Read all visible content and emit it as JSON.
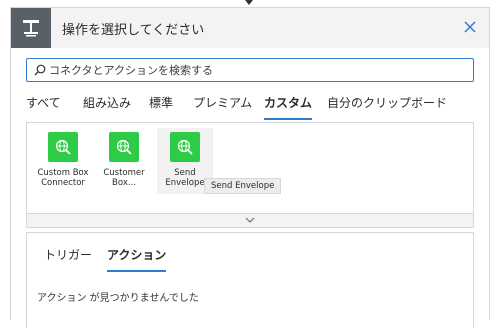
{
  "header": {
    "title": "操作を選択してください"
  },
  "search": {
    "placeholder": "コネクタとアクションを検索する",
    "value": ""
  },
  "tabs": [
    {
      "label": "すべて"
    },
    {
      "label": "組み込み"
    },
    {
      "label": "標準"
    },
    {
      "label": "プレミアム"
    },
    {
      "label": "カスタム",
      "active": true
    },
    {
      "label": "自分のクリップボード"
    }
  ],
  "connectors": [
    {
      "label": "Custom Box Connector",
      "icon": "globe-search-icon"
    },
    {
      "label": "Customer Box...",
      "icon": "globe-search-icon"
    },
    {
      "label": "Send Envelope",
      "icon": "globe-search-icon"
    }
  ],
  "tooltip": {
    "text": "Send Envelope"
  },
  "subtabs": [
    {
      "label": "トリガー"
    },
    {
      "label": "アクション",
      "active": true
    }
  ],
  "empty_message": "アクション が見つかりませんでした",
  "colors": {
    "accent": "#2e7bd4",
    "connector_green": "#2ecb47",
    "header_icon_bg": "#5a6068"
  }
}
